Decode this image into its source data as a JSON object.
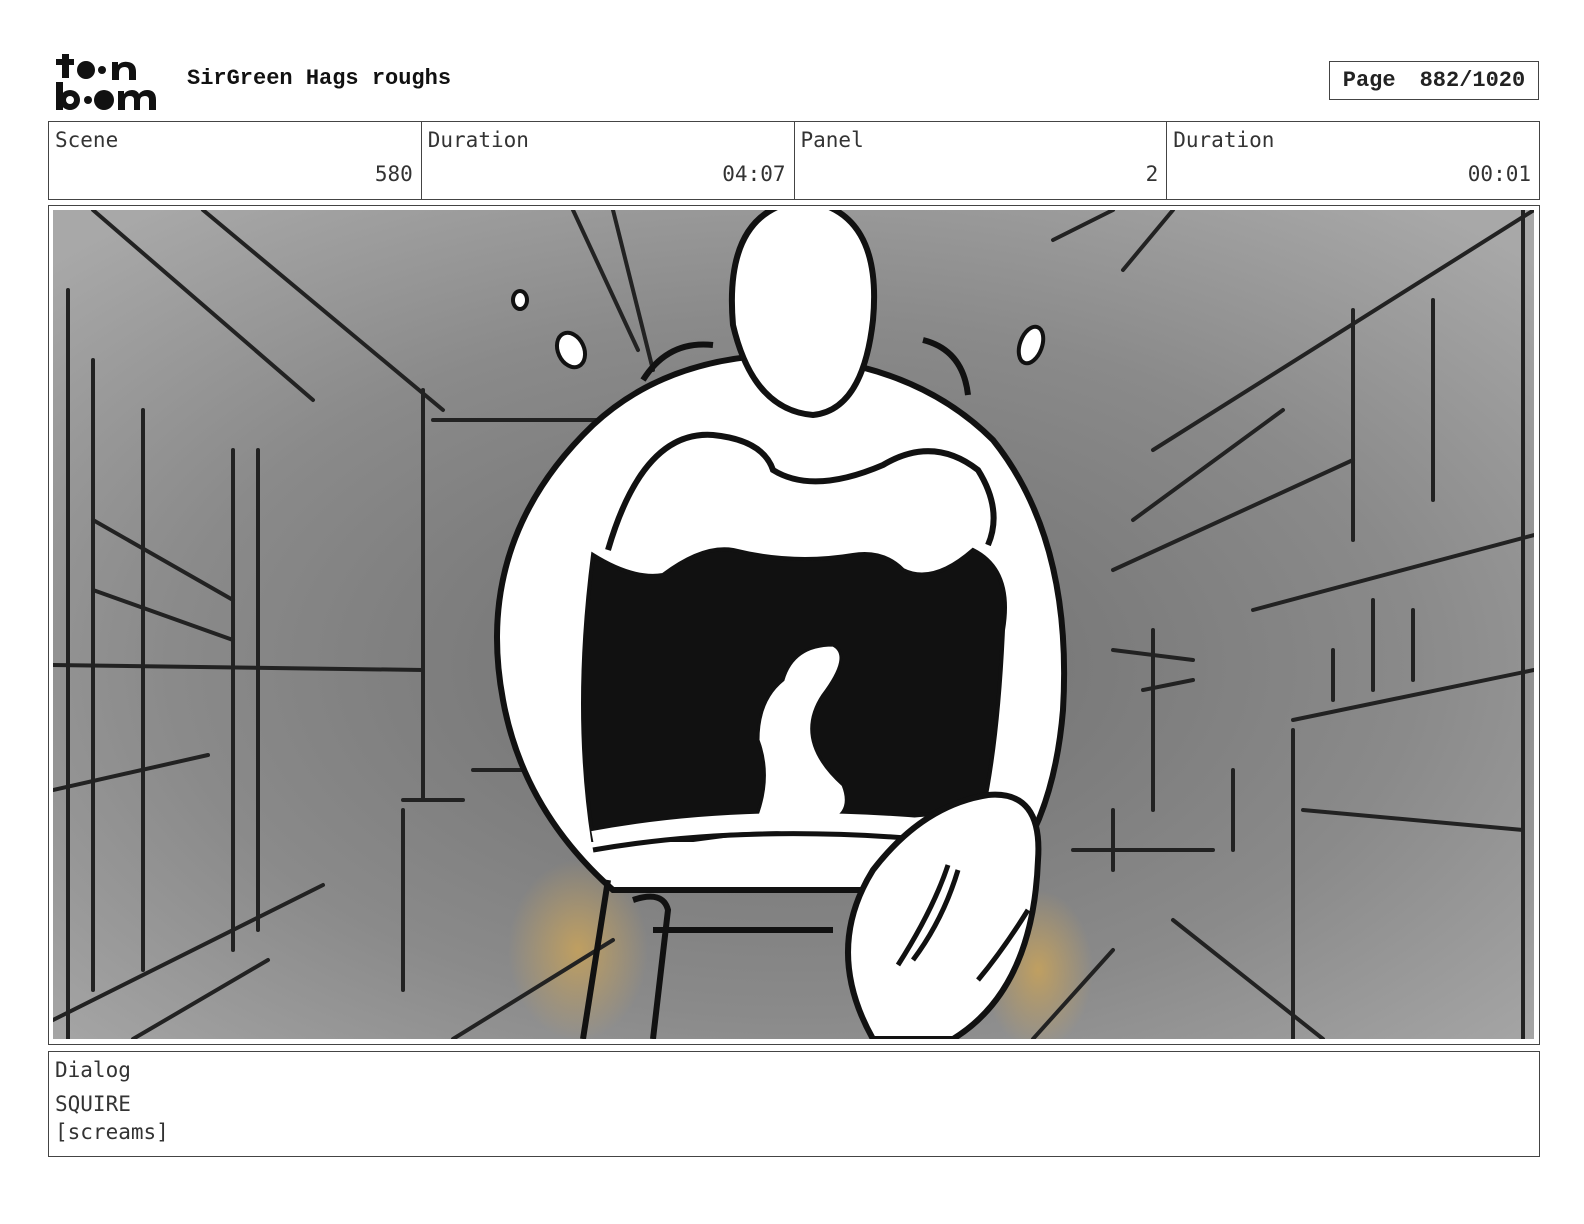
{
  "header": {
    "logo_text": "toon boom",
    "project_title": "SirGreen Hags roughs",
    "page_label": "Page",
    "page_value": "882/1020"
  },
  "info": {
    "scene_label": "Scene",
    "scene_value": "580",
    "scene_duration_label": "Duration",
    "scene_duration_value": "04:07",
    "panel_label": "Panel",
    "panel_value": "2",
    "panel_duration_label": "Duration",
    "panel_duration_value": "00:01"
  },
  "panel_image": {
    "description_icon": "storyboard-sketch-screaming-character"
  },
  "dialog": {
    "label": "Dialog",
    "speaker": "SQUIRE",
    "line": "[screams]"
  }
}
